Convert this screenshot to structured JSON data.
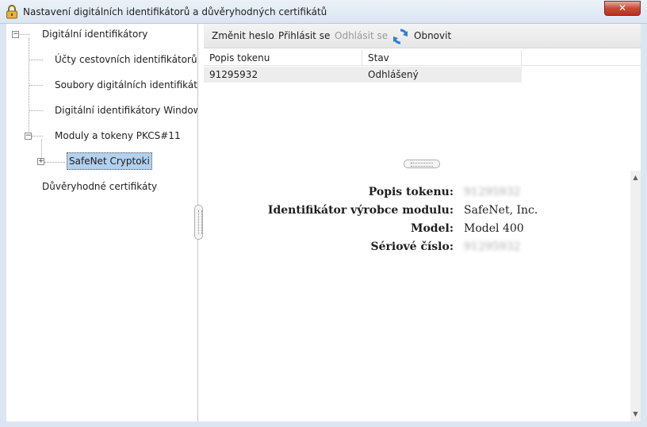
{
  "window": {
    "title": "Nastavení digitálních identifikátorů a důvěryhodných certifikátů",
    "close_label": "✕"
  },
  "tree": {
    "items": [
      {
        "label": "Digitální identifikátory",
        "expander": "−"
      },
      {
        "label": "Účty cestovních identifikátorů"
      },
      {
        "label": "Soubory digitálních identifikátorů"
      },
      {
        "label": "Digitální identifikátory Windows"
      },
      {
        "label": "Moduly a tokeny PKCS#11",
        "expander": "−"
      },
      {
        "label": "SafeNet Cryptoki",
        "expander": "+"
      },
      {
        "label": "Důvěryhodné certifikáty"
      }
    ]
  },
  "toolbar": {
    "change_password": "Změnit heslo",
    "login": "Přihlásit se",
    "logout": "Odhlásit se",
    "refresh": "Obnovit",
    "refresh_icon": "refresh-icon"
  },
  "table": {
    "columns": [
      "Popis tokenu",
      "Stav"
    ],
    "rows": [
      {
        "description": "91295932",
        "status": "Odhlášený"
      }
    ]
  },
  "details": {
    "rows": [
      {
        "label": "Popis tokenu:",
        "value": "91295932"
      },
      {
        "label": "Identifikátor výrobce modulu:",
        "value": "SafeNet, Inc."
      },
      {
        "label": "Model:",
        "value": "Model 400"
      },
      {
        "label": "Sériové číslo:",
        "value": "91295932"
      }
    ]
  },
  "colors": {
    "selection": "#b3d1ee",
    "close_button": "#c74a36",
    "refresh_icon": "#2a7fd4"
  }
}
